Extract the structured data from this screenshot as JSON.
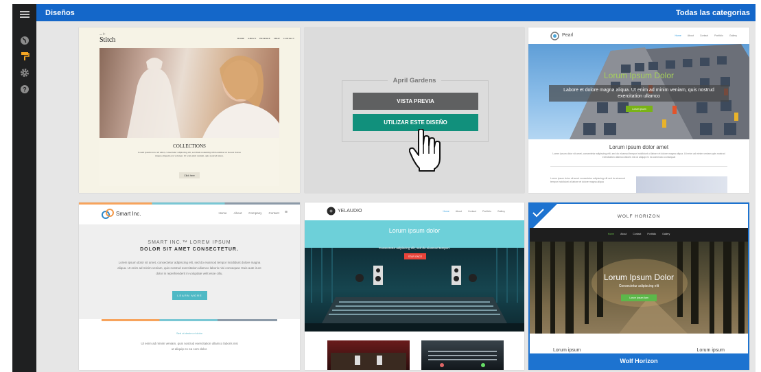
{
  "header": {
    "title": "Diseños",
    "categories": "Todas las categorias"
  },
  "sidebar": {
    "icons": [
      {
        "name": "menu-icon"
      },
      {
        "name": "globe-icon"
      },
      {
        "name": "paint-roller-icon"
      },
      {
        "name": "gear-icon"
      },
      {
        "name": "help-icon"
      }
    ],
    "active_color": "#f5a623"
  },
  "templates": [
    {
      "id": "stitch",
      "brand": "Stitch",
      "nav": [
        "HOME",
        "ABOUT",
        "BESPOKE",
        "SHOP",
        "CONTACT"
      ],
      "heading": "COLLECTIONS",
      "body": "Lorem ipsum dolor sit amet, consectetur adipiscing elit, sed diam nonummy nibh euismod ut laoreet dolore magna aliquam erat volutpat. Ut wisi enim veniam, quis nostrud tation.",
      "button": "Click here"
    },
    {
      "id": "april-gardens",
      "name": "April Gardens",
      "preview_label": "VISTA PREVIA",
      "use_label": "UTILIZAR ESTE DISEÑO"
    },
    {
      "id": "pearl",
      "brand": "Pearl",
      "nav": [
        "Home",
        "About",
        "Contact",
        "Portfolio",
        "Gallery"
      ],
      "hero_title": "Lorum Ipsum Dolor",
      "hero_text": "Labore et dolore magna aliqua. Ut enim ad minim veniam, quis nostrud exercitation ullamco",
      "hero_button": "Lorum ipsum",
      "section_title": "Lorum ipsum dolor amet",
      "section_text": "Lorem ipsum dolor sit amet, consectetur adipiscing elit, sed do eiusmod tempor incididunt ut labore et dolore magna aliqua. Ut enim ad minim veniam quis nostrud exercitation ullamco laboris nisi ut aliquip ex ea commodo consequat",
      "footer_text": "Lorem ipsum dolor sit amet consectetur adipiscing elit sed do eiusmod tempor incididunt ut labore et dolore magna aliqua"
    },
    {
      "id": "smart-inc",
      "brand": "Smart Inc.",
      "nav": [
        "Home",
        "About",
        "Company",
        "Contact"
      ],
      "hero_line1": "SMART INC.™ LOREM IPSUM",
      "hero_line2": "DOLOR SIT AMET CONSECTETUR.",
      "body": "Lorem ipsum dolor sit amet, consectetur adipiscing elit, sed do eiusmod tempor incididunt dolore magna aliqua. Ut enim ad minim veniam, quis nostrud exercitation ullamco laboris nisi consequat. Duis aute irure dolor in reprehenderit in voluptate velit esse cillu.",
      "button": "LEARN MORE",
      "subhead": "Sed ut denim et dolor",
      "foot_text": "Ut enim ad minim veniam, quis nostrud exercitation ullamco laboris nisi ut aliquip ex ea com dolor."
    },
    {
      "id": "yelaudio",
      "brand": "YELAUDIO",
      "nav": [
        "Home",
        "About",
        "Contact",
        "Portfolio",
        "Gallery"
      ],
      "hero_title": "Lorum ipsum dolor",
      "hero_text": "Consectetur adipiscing elit, sed do eiusmod tempori.",
      "hero_button": "STAR ONCE"
    },
    {
      "id": "wolf-horizon",
      "brand": "WOLF HORIZON",
      "nav": [
        "Home",
        "About",
        "Contact",
        "Portfolio",
        "Gallery"
      ],
      "hero_title": "Lorum Ipsum Dolor",
      "hero_text": "Consectetur adipiscing elit",
      "hero_button": "Lorum ipsum liam",
      "col1": "Lorum ipsum",
      "col2": "Lorum ipsum",
      "caption": "Wolf Horizon",
      "selected": true
    }
  ],
  "colors": {
    "topbar": "#1467c9",
    "rail": "#1f2021",
    "teal_button": "#11907c",
    "gray_button": "#5f6061",
    "selection": "#1d73d0",
    "green_accent": "#7ab317"
  }
}
